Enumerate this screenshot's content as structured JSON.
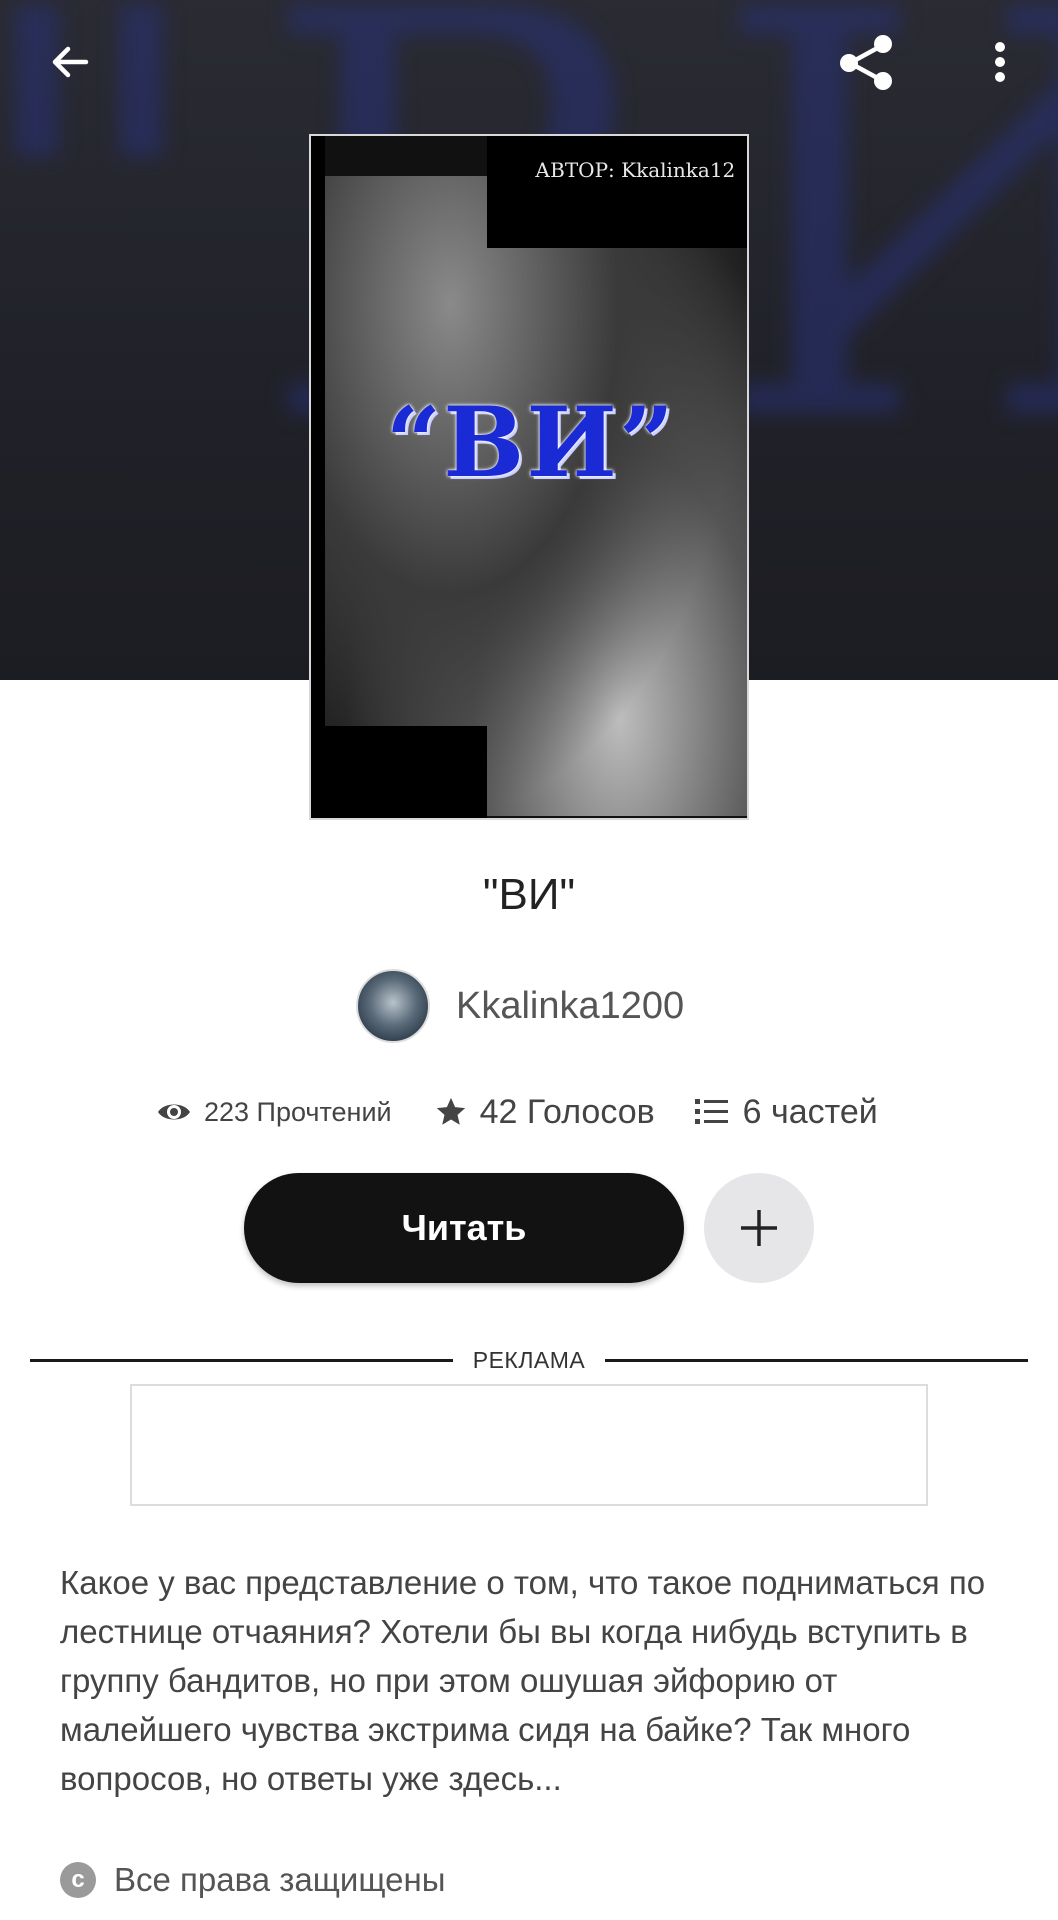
{
  "hero": {
    "background_text": "\"ВИ\""
  },
  "topbar": {
    "back_icon": "arrow-left-icon",
    "share_icon": "share-icon",
    "more_icon": "more-vertical-icon"
  },
  "cover": {
    "author_line": "АВТОР: Kkalinka12",
    "title": "“ВИ”",
    "title_color": "#1a2bd6"
  },
  "book": {
    "title": "\"ВИ\"",
    "author": "Kkalinka1200",
    "stats": {
      "reads": "223 Прочтений",
      "votes": "42 Голосов",
      "parts": "6 частей"
    }
  },
  "actions": {
    "read_label": "Читать",
    "add_icon": "plus-icon"
  },
  "ad": {
    "label": "РЕКЛАМА"
  },
  "description": "Какое у вас представление о том, что такое подниматься по лестнице отчаяния? Хотели бы вы когда нибудь вступить в группу бандитов, но при этом ошушая эйфорию от малейшего чувства экстрима сидя на байке? Так много вопросов, но ответы уже здесь...",
  "rights": {
    "icon": "copyright-icon",
    "text": "Все права защищены"
  }
}
